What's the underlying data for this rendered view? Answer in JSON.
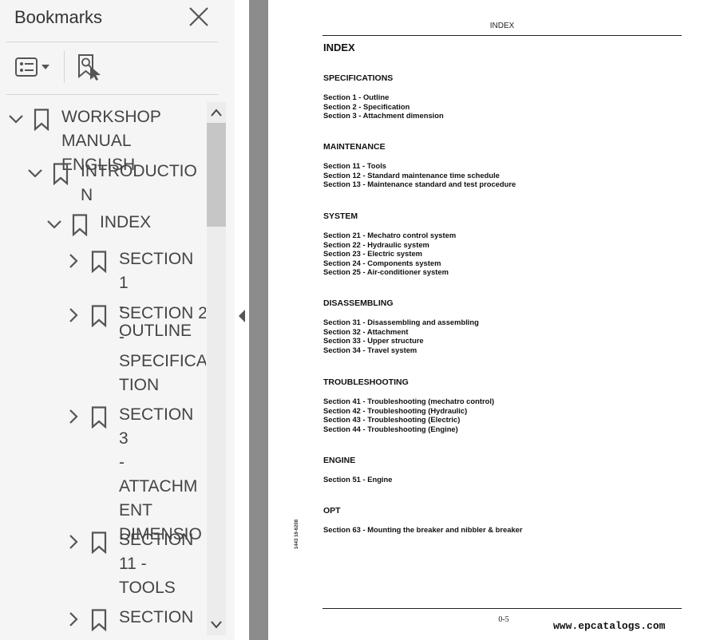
{
  "panel": {
    "title": "Bookmarks",
    "tree": [
      {
        "label": "WORKSHOP\nMANUAL ENGLISH",
        "state": "expanded"
      },
      {
        "label": "INTRODUCTIO\nN",
        "state": "expanded"
      },
      {
        "label": "INDEX",
        "state": "expanded"
      },
      {
        "label": "SECTION 1\n- OUTLINE",
        "state": "collapsed"
      },
      {
        "label": "SECTION 2\n-\nSPECIFICA\nTION",
        "state": "collapsed"
      },
      {
        "label": "SECTION 3\n-\nATTACHM\nENT\nDIMENSIO",
        "state": "collapsed"
      },
      {
        "label": "SECTION\n11 -\nTOOLS",
        "state": "collapsed"
      },
      {
        "label": "SECTION",
        "state": "collapsed"
      }
    ],
    "icons": {
      "close": "close-icon",
      "options": "options-icon",
      "find": "find-bookmark-icon",
      "bookmark": "bookmark-icon",
      "expanded": "chevron-down-icon",
      "collapsed": "chevron-right-icon"
    }
  },
  "document": {
    "header": "INDEX",
    "title": "INDEX",
    "sections": [
      {
        "heading": "SPECIFICATIONS",
        "entries": [
          "Section 1 - Outline",
          "Section 2 - Specification",
          "Section 3 - Attachment dimension"
        ]
      },
      {
        "heading": "MAINTENANCE",
        "entries": [
          "Section 11 - Tools",
          "Section 12 - Standard maintenance time schedule",
          "Section 13 - Maintenance standard and test procedure"
        ]
      },
      {
        "heading": "SYSTEM",
        "entries": [
          "Section 21 - Mechatro control system",
          "Section 22 - Hydraulic system",
          "Section 23 - Electric system",
          "Section 24 - Components system",
          "Section 25 - Air-conditioner system"
        ]
      },
      {
        "heading": "DISASSEMBLING",
        "entries": [
          "Section 31 - Disassembling and assembling",
          "Section 32 - Attachment",
          "Section 33 - Upper structure",
          "Section 34 - Travel system"
        ]
      },
      {
        "heading": "TROUBLESHOOTING",
        "entries": [
          "Section 41 - Troubleshooting (mechatro control)",
          "Section 42 - Troubleshooting (Hydraulic)",
          "Section 43 - Troubleshooting (Electric)",
          "Section 44 - Troubleshooting (Engine)"
        ]
      },
      {
        "heading": "ENGINE",
        "entries": [
          "Section 51 - Engine"
        ]
      },
      {
        "heading": "OPT",
        "entries": [
          "Section 63 - Mounting the breaker and nibbler & breaker"
        ]
      }
    ],
    "side_code": "1443  16-6208",
    "page_number": "0-5",
    "watermark": "www.epcatalogs.com"
  },
  "colors": {
    "panel_bg": "#f5f5f5",
    "icon": "#555555",
    "gutter": "#8c8c8c",
    "text": "#111111"
  }
}
